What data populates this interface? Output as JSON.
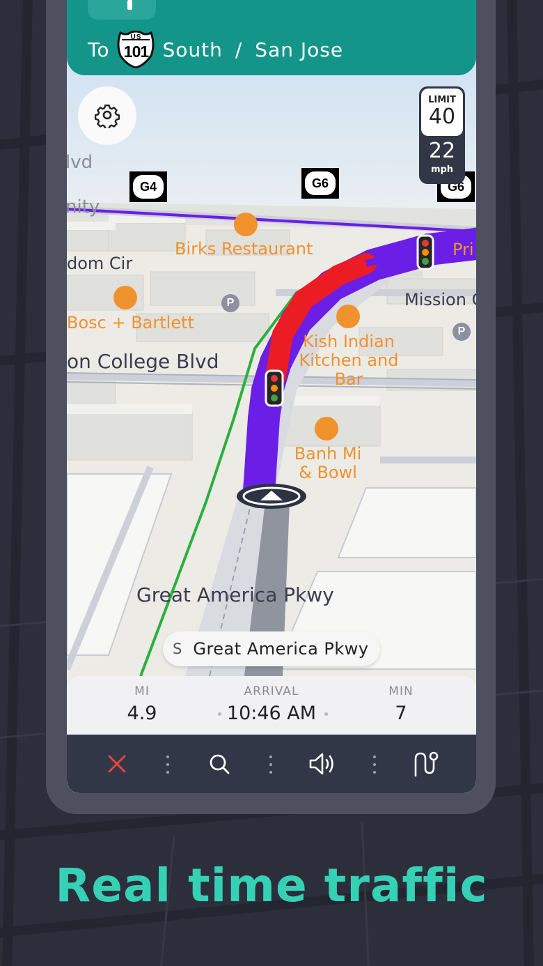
{
  "navigation": {
    "direction_prefix": "To",
    "route_shield": {
      "country": "US",
      "number": "101"
    },
    "direction": "South",
    "separator": "/",
    "destination": "San Jose"
  },
  "speed": {
    "limit_label": "LIMIT",
    "limit_value": "40",
    "current_value": "22",
    "unit": "mph"
  },
  "route_signs": [
    "G4",
    "G6",
    "G6"
  ],
  "map_labels": {
    "streets": [
      "lvd",
      "nity",
      "dom Cir",
      "on College Blvd",
      "Great America Pkwy",
      "Mission C"
    ],
    "pois": [
      "Birks Restaurant",
      "Bosc + Bartlett",
      "Kish Indian Kitchen and Bar",
      "Banh Mi & Bowl",
      "Pri"
    ],
    "parking": "P"
  },
  "current_street": {
    "direction": "S",
    "name": "Great America Pkwy"
  },
  "trip": {
    "distance_label": "MI",
    "distance_value": "4.9",
    "arrival_label": "ARRIVAL",
    "arrival_value": "10:46 AM",
    "time_label": "MIN",
    "time_value": "7"
  },
  "toolbar": {
    "buttons": [
      "close-icon",
      "search-icon",
      "volume-icon",
      "route-options-icon"
    ]
  },
  "promo_text": "Real time traffic",
  "colors": {
    "banner": "#14958a",
    "route": "#6b1fe6",
    "traffic_heavy": "#ec1c24",
    "poi": "#f0922d",
    "promo": "#35d1b5",
    "toolbar": "#313747",
    "close": "#e8453c"
  }
}
